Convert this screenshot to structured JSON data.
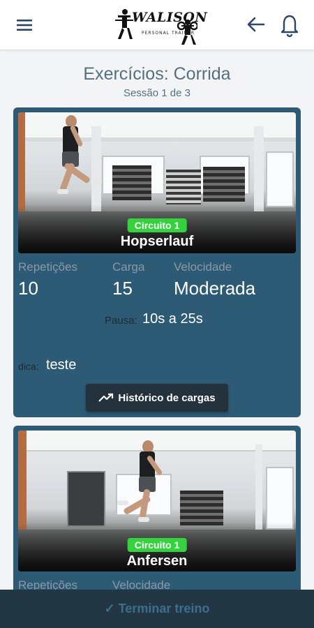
{
  "header": {
    "logo_text": "WALISON",
    "logo_subtitle": "PERSONAL TRAINER",
    "icons": {
      "menu": "menu-icon",
      "back": "arrow-back-icon",
      "notifications": "bell-icon"
    }
  },
  "page": {
    "title": "Exercícios: Corrida",
    "session": "Sessão 1 de 3"
  },
  "exercises": [
    {
      "circuit": "Circuito 1",
      "name": "Hopserlauf",
      "stats": [
        {
          "label": "Repetições",
          "value": "10"
        },
        {
          "label": "Carga",
          "value": "15"
        },
        {
          "label": "Velocidade",
          "value": "Moderada"
        }
      ],
      "pause_label": "Pausa:",
      "pause_value": "10s a 25s",
      "tip_label": "dica:",
      "tip_value": "teste",
      "history_button": "Histórico de cargas"
    },
    {
      "circuit": "Circuito 1",
      "name": "Anfersen",
      "stats": [
        {
          "label": "Repetições",
          "value": ""
        },
        {
          "label": "Velocidade",
          "value": ""
        }
      ]
    }
  ],
  "footer": {
    "finish_label": "✓ Terminar treino"
  },
  "colors": {
    "card": "#2d5a75",
    "badge": "#34d33d",
    "footer": "#223644",
    "title_text": "#54707f"
  }
}
